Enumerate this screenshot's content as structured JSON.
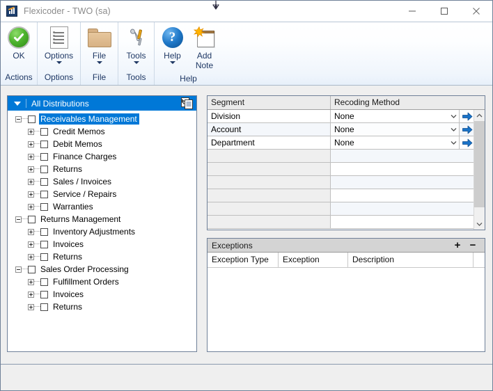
{
  "window": {
    "app_icon": "chart-app-icon",
    "title": "Flexicoder  -  TWO (sa)",
    "minimize_label": "Minimize",
    "maximize_label": "Maximize",
    "close_label": "Close"
  },
  "cursor": {
    "type": "resize-vertical-cursor"
  },
  "ribbon": {
    "groups": [
      {
        "label": "Actions",
        "buttons": [
          {
            "label": "OK",
            "icon": "green-check-circle-icon",
            "has_caret": false
          }
        ]
      },
      {
        "label": "Options",
        "buttons": [
          {
            "label": "Options",
            "icon": "document-list-icon",
            "has_caret": true
          }
        ]
      },
      {
        "label": "File",
        "buttons": [
          {
            "label": "File",
            "icon": "folder-icon",
            "has_caret": true
          }
        ]
      },
      {
        "label": "Tools",
        "buttons": [
          {
            "label": "Tools",
            "icon": "wrench-screwdriver-icon",
            "has_caret": true
          }
        ]
      },
      {
        "label": "Help",
        "buttons": [
          {
            "label": "Help",
            "icon": "blue-question-circle-icon",
            "has_caret": true
          },
          {
            "label": "Add Note",
            "icon": "new-note-icon",
            "has_caret": false
          }
        ]
      }
    ]
  },
  "tree": {
    "header": {
      "title": "All Distributions",
      "caret_icon": "chevron-down-icon",
      "action_icon": "copy-document-icon"
    },
    "nodes": [
      {
        "label": "Receivables Management",
        "level": 1,
        "expander": "minus",
        "selected": true
      },
      {
        "label": "Credit Memos",
        "level": 2,
        "expander": "plus",
        "selected": false
      },
      {
        "label": "Debit Memos",
        "level": 2,
        "expander": "plus",
        "selected": false
      },
      {
        "label": "Finance Charges",
        "level": 2,
        "expander": "plus",
        "selected": false
      },
      {
        "label": "Returns",
        "level": 2,
        "expander": "plus",
        "selected": false
      },
      {
        "label": "Sales / Invoices",
        "level": 2,
        "expander": "plus",
        "selected": false
      },
      {
        "label": "Service / Repairs",
        "level": 2,
        "expander": "plus",
        "selected": false
      },
      {
        "label": "Warranties",
        "level": 2,
        "expander": "plus",
        "selected": false
      },
      {
        "label": "Returns Management",
        "level": 1,
        "expander": "minus",
        "selected": false
      },
      {
        "label": "Inventory Adjustments",
        "level": 2,
        "expander": "plus",
        "selected": false
      },
      {
        "label": "Invoices",
        "level": 2,
        "expander": "plus",
        "selected": false
      },
      {
        "label": "Returns",
        "level": 2,
        "expander": "plus",
        "selected": false
      },
      {
        "label": "Sales Order Processing",
        "level": 1,
        "expander": "minus",
        "selected": false
      },
      {
        "label": "Fulfillment Orders",
        "level": 2,
        "expander": "plus",
        "selected": false
      },
      {
        "label": "Invoices",
        "level": 2,
        "expander": "plus",
        "selected": false
      },
      {
        "label": "Returns",
        "level": 2,
        "expander": "plus",
        "selected": false
      }
    ]
  },
  "segment_grid": {
    "columns": [
      "Segment",
      "Recoding Method"
    ],
    "rows": [
      {
        "segment": "Division",
        "method": "None",
        "go_icon": "blue-arrow-right-icon",
        "dropdown_icon": "chevron-down-icon"
      },
      {
        "segment": "Account",
        "method": "None",
        "go_icon": "blue-arrow-right-icon",
        "dropdown_icon": "chevron-down-icon"
      },
      {
        "segment": "Department",
        "method": "None",
        "go_icon": "blue-arrow-right-icon",
        "dropdown_icon": "chevron-down-icon"
      }
    ],
    "empty_row_count": 6,
    "scroll_up_icon": "chevron-up-icon",
    "scroll_down_icon": "chevron-down-icon"
  },
  "exceptions": {
    "title": "Exceptions",
    "add_label": "+",
    "remove_label": "−",
    "columns": [
      "Exception Type",
      "Exception",
      "Description"
    ],
    "rows": []
  },
  "colors": {
    "accent_blue": "#0078d7",
    "ribbon_text": "#1f3864",
    "window_border": "#6f8098",
    "panel_bg": "#efefef"
  }
}
